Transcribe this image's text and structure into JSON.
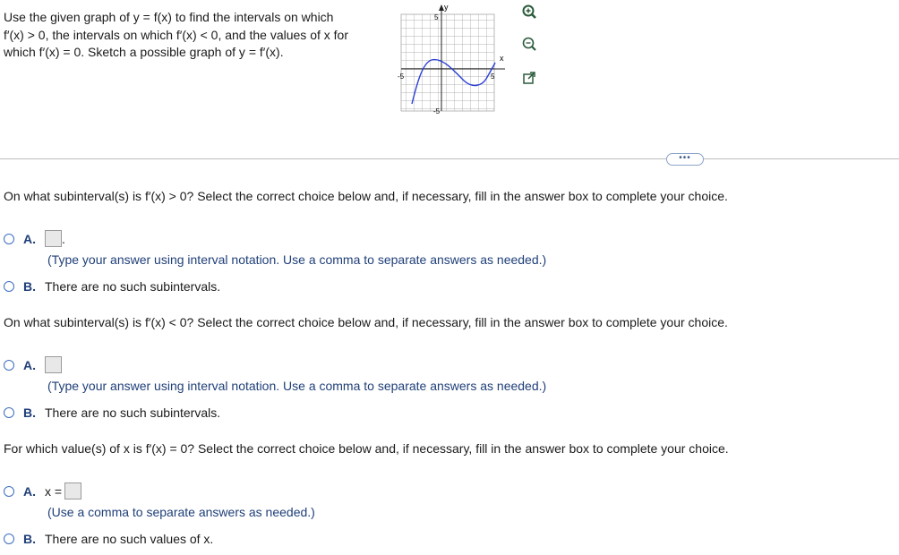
{
  "prompt": {
    "line1": "Use the given graph of y = f(x) to find the intervals on which",
    "line2": "f′(x) > 0, the intervals on which f′(x) < 0, and the values of x for",
    "line3": "which f′(x) = 0. Sketch a possible graph of y = f′(x)."
  },
  "graph": {
    "y_axis_label": "y",
    "x_axis_label": "x",
    "tick_y_pos": "5",
    "tick_y_neg": "-5",
    "tick_x_neg": "-5",
    "tick_x_pos": "5",
    "curve_color": "#2b3fd6"
  },
  "tools": {
    "zoom_in": "zoom-in-icon",
    "zoom_out": "zoom-out-icon",
    "popout": "popout-icon"
  },
  "more_label": "•••",
  "q1": {
    "text": "On what subinterval(s) is f′(x) > 0? Select the correct choice below and, if necessary, fill in the answer box to complete your choice.",
    "a_label": "A.",
    "a_suffix": ".",
    "a_hint": "(Type your answer using interval notation. Use a comma to separate answers as needed.)",
    "b_label": "B.",
    "b_text": "There are no such subintervals."
  },
  "q2": {
    "text": "On what subinterval(s) is f′(x) < 0? Select the correct choice below and, if necessary, fill in the answer box to complete your choice.",
    "a_label": "A.",
    "a_hint": "(Type your answer using interval notation. Use a comma to separate answers as needed.)",
    "b_label": "B.",
    "b_text": "There are no such subintervals."
  },
  "q3": {
    "text": "For which value(s) of x is f′(x) = 0? Select the correct choice below and, if necessary, fill in the answer box to complete your choice.",
    "a_label": "A.",
    "a_prefix": "x =",
    "a_hint": "(Use a comma to separate answers as needed.)",
    "b_label": "B.",
    "b_text": "There are no such values of x."
  },
  "colors": {
    "accent": "#1f3f78",
    "radio": "#3d6ec0"
  }
}
